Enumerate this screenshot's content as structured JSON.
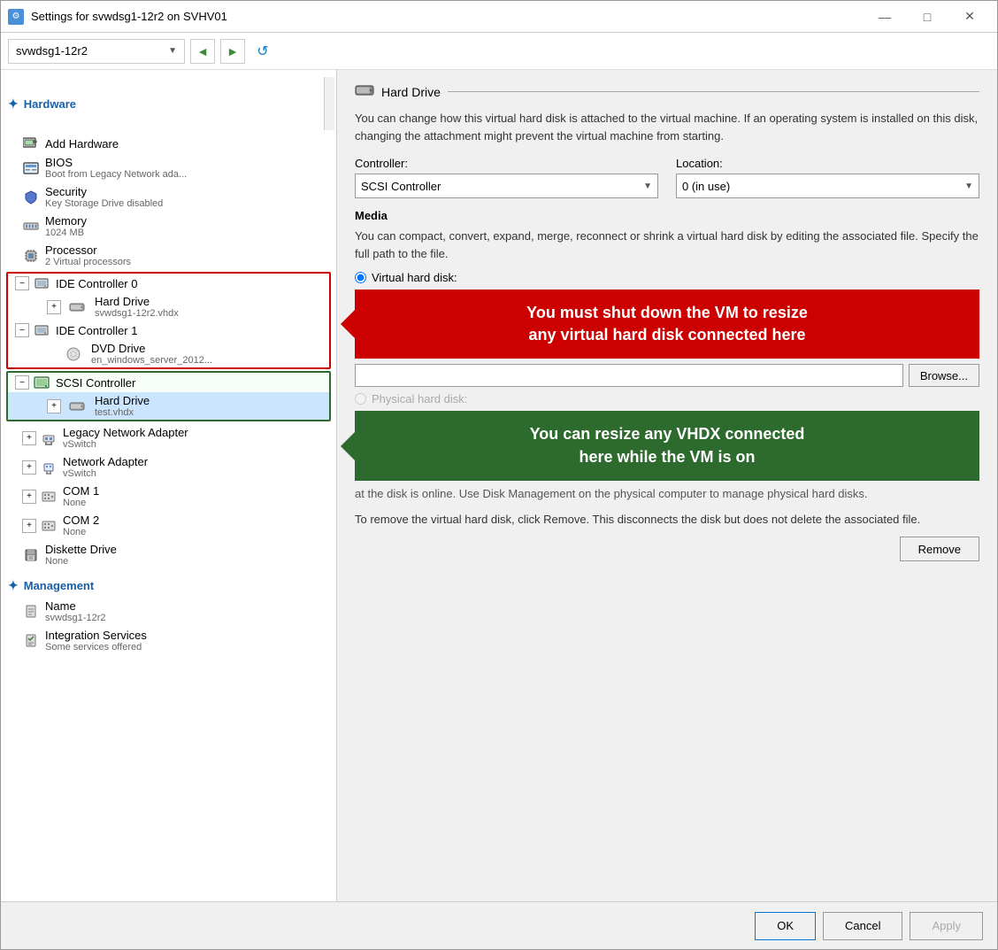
{
  "window": {
    "title": "Settings for svwdsg1-12r2 on SVHV01",
    "icon": "⚙"
  },
  "toolbar": {
    "vm_name": "svwdsg1-12r2",
    "back_label": "◄",
    "forward_label": "►",
    "refresh_label": "↺"
  },
  "sidebar": {
    "hardware_section": "Hardware",
    "management_section": "Management",
    "items": [
      {
        "id": "add-hardware",
        "label": "Add Hardware",
        "sublabel": "",
        "icon": "🖥",
        "level": 1
      },
      {
        "id": "bios",
        "label": "BIOS",
        "sublabel": "Boot from Legacy Network ada...",
        "icon": "📋",
        "level": 1
      },
      {
        "id": "security",
        "label": "Security",
        "sublabel": "Key Storage Drive disabled",
        "icon": "🛡",
        "level": 1
      },
      {
        "id": "memory",
        "label": "Memory",
        "sublabel": "1024 MB",
        "icon": "🧩",
        "level": 1
      },
      {
        "id": "processor",
        "label": "Processor",
        "sublabel": "2 Virtual processors",
        "icon": "🔲",
        "level": 1
      },
      {
        "id": "ide-controller-0",
        "label": "IDE Controller 0",
        "sublabel": "",
        "icon": "💾",
        "level": 1,
        "expanded": true,
        "bordered": "red"
      },
      {
        "id": "ide0-hard-drive",
        "label": "Hard Drive",
        "sublabel": "svwdsg1-12r2.vhdx",
        "icon": "💿",
        "level": 2,
        "bordered": "red"
      },
      {
        "id": "ide-controller-1",
        "label": "IDE Controller 1",
        "sublabel": "",
        "icon": "💾",
        "level": 1,
        "expanded": true,
        "bordered": "red"
      },
      {
        "id": "ide1-dvd-drive",
        "label": "DVD Drive",
        "sublabel": "en_windows_server_2012...",
        "icon": "💿",
        "level": 2,
        "bordered": "red"
      },
      {
        "id": "scsi-controller",
        "label": "SCSI Controller",
        "sublabel": "",
        "icon": "🔗",
        "level": 1,
        "expanded": true,
        "bordered": "green"
      },
      {
        "id": "scsi-hard-drive",
        "label": "Hard Drive",
        "sublabel": "test.vhdx",
        "icon": "💿",
        "level": 2,
        "bordered": "green",
        "selected": true
      },
      {
        "id": "legacy-network",
        "label": "Legacy Network Adapter",
        "sublabel": "vSwitch",
        "icon": "🔌",
        "level": 1
      },
      {
        "id": "network-adapter",
        "label": "Network Adapter",
        "sublabel": "vSwitch",
        "icon": "🔌",
        "level": 1
      },
      {
        "id": "com1",
        "label": "COM 1",
        "sublabel": "None",
        "icon": "🔌",
        "level": 1
      },
      {
        "id": "com2",
        "label": "COM 2",
        "sublabel": "None",
        "icon": "🔌",
        "level": 1
      },
      {
        "id": "diskette",
        "label": "Diskette Drive",
        "sublabel": "None",
        "icon": "💾",
        "level": 1
      }
    ],
    "management_items": [
      {
        "id": "name",
        "label": "Name",
        "sublabel": "svwdsg1-12r2",
        "icon": "📝"
      },
      {
        "id": "integration",
        "label": "Integration Services",
        "sublabel": "Some services offered",
        "icon": "📄"
      }
    ]
  },
  "right_panel": {
    "title": "Hard Drive",
    "description": "You can change how this virtual hard disk is attached to the virtual machine. If an operating system is installed on this disk, changing the attachment might prevent the virtual machine from starting.",
    "controller_label": "Controller:",
    "controller_value": "SCSI Controller",
    "location_label": "Location:",
    "location_value": "0 (in use)",
    "media_title": "Media",
    "media_description": "You can compact, convert, expand, merge, reconnect or shrink a virtual hard disk by editing the associated file. Specify the full path to the file.",
    "virtual_hd_label": "Virtual hard disk:",
    "path_placeholder": "",
    "physical_hd_label": "Physical hard disk:",
    "browse_label": "Browse...",
    "red_banner": "You must shut down the VM to resize\nany virtual hard disk connected here",
    "green_banner": "You can resize any VHDX connected\nhere while the VM is on",
    "physical_disk_note": "at the disk is online. Use Disk Management on the physical computer to manage physical hard disks.",
    "remove_text": "To remove the virtual hard disk, click Remove. This disconnects the disk but does not delete the associated file.",
    "remove_label": "Remove"
  },
  "bottom_bar": {
    "ok_label": "OK",
    "cancel_label": "Cancel",
    "apply_label": "Apply"
  }
}
